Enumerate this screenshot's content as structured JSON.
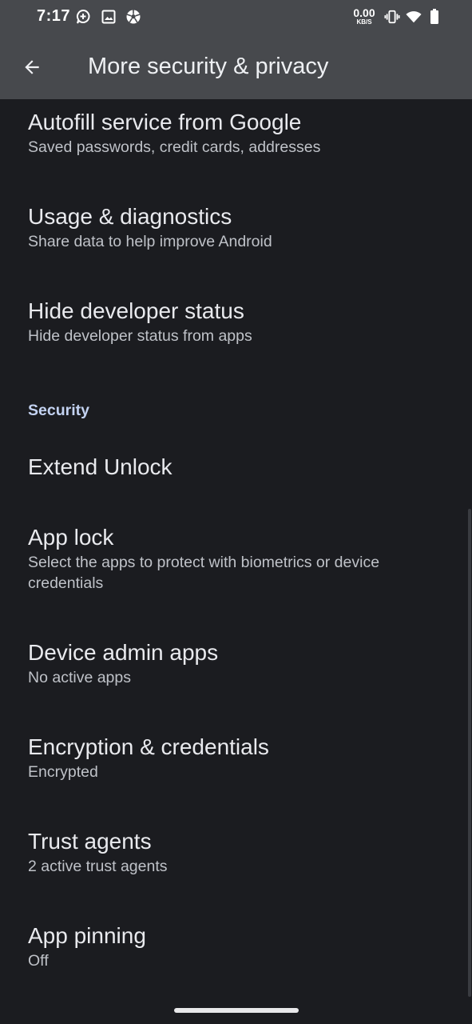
{
  "status_bar": {
    "time": "7:17",
    "net_speed_value": "0.00",
    "net_speed_unit": "KB/S",
    "icons": [
      "assistant-icon",
      "image-icon",
      "soccer-ball-icon",
      "vibrate-icon",
      "wifi-icon",
      "battery-icon"
    ]
  },
  "toolbar": {
    "title": "More security & privacy",
    "back_icon": "arrow-back-icon"
  },
  "items": [
    {
      "title": "Autofill service from Google",
      "summary": "Saved passwords, credit cards, addresses"
    },
    {
      "title": "Usage & diagnostics",
      "summary": "Share data to help improve Android"
    },
    {
      "title": "Hide developer status",
      "summary": "Hide developer status from apps"
    }
  ],
  "security_section": {
    "header": "Security",
    "items": [
      {
        "title": "Extend Unlock",
        "summary": ""
      },
      {
        "title": "App lock",
        "summary": "Select the apps to protect with biometrics or device credentials"
      },
      {
        "title": "Device admin apps",
        "summary": "No active apps"
      },
      {
        "title": "Encryption & credentials",
        "summary": "Encrypted"
      },
      {
        "title": "Trust agents",
        "summary": "2 active trust agents"
      },
      {
        "title": "App pinning",
        "summary": "Off"
      }
    ]
  },
  "colors": {
    "background": "#1b1c20",
    "toolbar": "#47494d",
    "accent": "#c3d2f1"
  }
}
